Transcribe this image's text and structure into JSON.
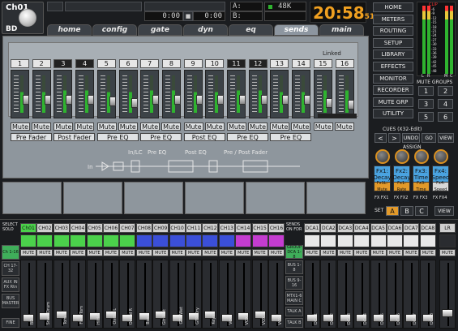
{
  "channel": {
    "id": "Ch01",
    "name": "BD"
  },
  "top": {
    "time_display": "0:00",
    "time_display2": "0:00",
    "bus_a": "A:",
    "bus_b": "B:",
    "rate": "48K",
    "clock": "20:58",
    "clock_seconds": "51"
  },
  "tabs": [
    "home",
    "config",
    "gate",
    "dyn",
    "eq",
    "sends",
    "main"
  ],
  "active_tab": "sends",
  "sends": {
    "linked_label": "Linked",
    "channels": [
      "1",
      "2",
      "3",
      "4",
      "5",
      "6",
      "7",
      "8",
      "9",
      "10",
      "11",
      "12",
      "13",
      "14",
      "15",
      "16"
    ],
    "dark_channels": [
      3,
      4,
      11,
      12
    ],
    "mute_label": "Mute",
    "tap_labels": [
      "Pre Fader",
      "Post Fader",
      "Pre EQ",
      "Pre EQ",
      "Post EQ",
      "Pre EQ",
      "Pre EQ"
    ],
    "signal_flow": {
      "in": "In",
      "in_lc": "In/LC",
      "pre_eq": "Pre EQ",
      "post_eq": "Post EQ",
      "pre_post_fader": "Pre / Post Fader"
    }
  },
  "right_menu": [
    "HOME",
    "METERS",
    "ROUTING",
    "SETUP",
    "LIBRARY",
    "EFFECTS",
    "MONITOR",
    "RECORDER",
    "MUTE GRP",
    "UTILITY"
  ],
  "mute_groups": {
    "title": "MUTE GROUPS",
    "buttons": [
      "1",
      "2",
      "3",
      "4",
      "5",
      "6"
    ]
  },
  "cues": {
    "title": "CUES (X32-Edit)",
    "undo": "UNDO",
    "go": "GO",
    "view": "VIEW",
    "prev": "<",
    "next": ">"
  },
  "assign": {
    "title": "ASSIGN",
    "fx_buttons": [
      "Fx1: Decay",
      "Fx2: Decay",
      "Fx3: Time",
      "Fx4: Speed"
    ],
    "fx_mute": [
      "Fx1L: Mute",
      "Fx1: Rate",
      "Fx3: Time",
      "Fx4: Speed"
    ],
    "fx_labels": [
      "FX FX1",
      "FX FX2",
      "FX FX3",
      "FX FX4"
    ],
    "set_label": "SET",
    "set_buttons": [
      "A",
      "B",
      "C"
    ],
    "view": "VIEW"
  },
  "meters": {
    "clip": "CLIP",
    "labels": [
      "L",
      "R",
      "M",
      "C"
    ],
    "scale": [
      "-6",
      "-9",
      "-12",
      "-15",
      "-18",
      "-21",
      "-24",
      "-27",
      "-30",
      "-33",
      "-36",
      "-39",
      "-42",
      "-45",
      "-48"
    ]
  },
  "bottom": {
    "select_solo": "SELECT SOLO",
    "left_buttons": [
      "Ch 1-16",
      "CH 17-32",
      "AUX IN FX Rtn",
      "BUS MASTER"
    ],
    "fine": "FINE",
    "channels": [
      {
        "id": "Ch01",
        "name": "BD",
        "color": "#4bd14b"
      },
      {
        "id": "CH02",
        "name": "SnareDrum",
        "color": "#4bd14b"
      },
      {
        "id": "CH03",
        "name": "Tom",
        "color": "#4bd14b"
      },
      {
        "id": "CH04",
        "name": "FloorTom",
        "color": "#4bd14b"
      },
      {
        "id": "CH05",
        "name": "HiHat",
        "color": "#4bd14b"
      },
      {
        "id": "CH06",
        "name": "Ovrhd L",
        "color": "#4bd14b"
      },
      {
        "id": "CH07",
        "name": "Ovrhd R",
        "color": "#4bd14b"
      },
      {
        "id": "CH08",
        "name": "Bass",
        "color": "#3b4fd8"
      },
      {
        "id": "CH09",
        "name": "Gtr Wet",
        "color": "#3b4fd8"
      },
      {
        "id": "CH10",
        "name": "GTR Wet",
        "color": "#3b4fd8"
      },
      {
        "id": "CH11",
        "name": "GTR Dry",
        "color": "#3b4fd8"
      },
      {
        "id": "CH12",
        "name": "Keys",
        "color": "#3b4fd8"
      },
      {
        "id": "CH13",
        "name": "Vox",
        "color": "#3b4fd8"
      },
      {
        "id": "CH14",
        "name": "VOX",
        "color": "#c43cd0"
      },
      {
        "id": "CH15",
        "name": "VOX",
        "color": "#c43cd0"
      },
      {
        "id": "CH16",
        "name": "VOX",
        "color": "#c43cd0"
      }
    ],
    "sends_on_fdr": "SENDS ON FDR",
    "group_buttons": [
      "GROUP DCA 1-8",
      "BUS 1-8",
      "BUS 9-16",
      "MTX1-6 MAIN C"
    ],
    "talk": [
      "TALK A",
      "TALK B"
    ],
    "dcas": [
      "DCA1",
      "DCA2",
      "DCA3",
      "DCA4",
      "DCA5",
      "DCA6",
      "DCA7",
      "DCA8"
    ],
    "lr": "LR",
    "mute": "MUTE"
  }
}
